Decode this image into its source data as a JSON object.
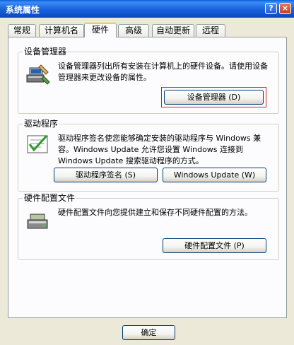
{
  "window": {
    "title": "系统属性",
    "help_label": "?",
    "close_label": "×"
  },
  "tabs": [
    {
      "label": "常规",
      "active": false
    },
    {
      "label": "计算机名",
      "active": false
    },
    {
      "label": "硬件",
      "active": true
    },
    {
      "label": "高级",
      "active": false
    },
    {
      "label": "自动更新",
      "active": false
    },
    {
      "label": "远程",
      "active": false
    }
  ],
  "device_manager": {
    "title": "设备管理器",
    "description": "设备管理器列出所有安装在计算机上的硬件设备。请使用设备管理器来更改设备的属性。",
    "button": "设备管理器 (D)",
    "icon": "device-manager-icon"
  },
  "drivers": {
    "title": "驱动程序",
    "description": "驱动程序签名使您能够确定安装的驱动程序与 Windows 兼容。Windows Update 允许您设置 Windows 连接到 Windows Update 搜索驱动程序的方式。",
    "signing_button": "驱动程序签名 (S)",
    "update_button": "Windows Update (W)",
    "icon": "driver-signing-icon"
  },
  "hardware_profiles": {
    "title": "硬件配置文件",
    "description": "硬件配置文件向您提供建立和保存不同硬件配置的方法。",
    "button": "硬件配置文件 (P)",
    "icon": "hardware-profile-icon"
  },
  "footer": {
    "ok_button": "确定"
  },
  "colors": {
    "titlebar": "#0a5fd8",
    "face": "#ece9d8",
    "panel": "#fcfcfe",
    "highlight": "#c8202a",
    "active_tab_accent": "#ffc83c"
  }
}
